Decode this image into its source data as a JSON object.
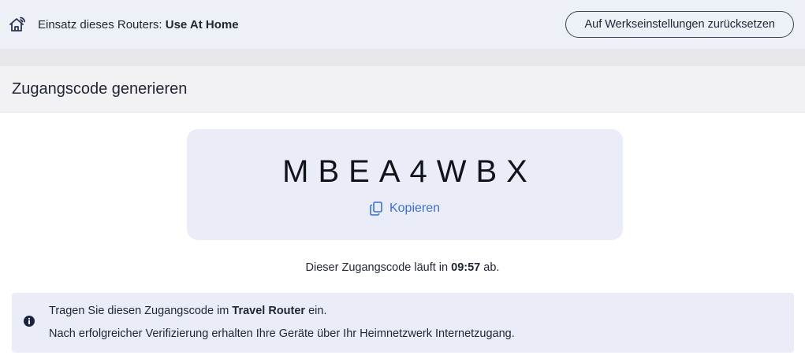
{
  "header": {
    "router_use_label": "Einsatz dieses Routers:",
    "router_use_value": "Use At Home",
    "reset_button_label": "Auf Werkseinstellungen zurücksetzen",
    "home_icon": "home-wifi-icon"
  },
  "section": {
    "title": "Zugangscode generieren"
  },
  "code_card": {
    "code": "MBEA4WBX",
    "copy_label": "Kopieren",
    "copy_icon": "copy-icon"
  },
  "expiry": {
    "prefix": "Dieser Zugangscode läuft in",
    "time": "09:57",
    "suffix": "ab."
  },
  "info": {
    "icon": "info-icon",
    "line1_prefix": "Tragen Sie diesen Zugangscode im",
    "line1_bold": "Travel Router",
    "line1_suffix": "ein.",
    "line2": "Nach erfolgreicher Verifizierung erhalten Ihre Geräte über Ihr Heimnetzwerk Internetzugang."
  },
  "colors": {
    "accent": "#3b6fd6",
    "card_bg": "#eaedf8",
    "topbar_bg": "#eef0f8",
    "text": "#1f2533"
  }
}
